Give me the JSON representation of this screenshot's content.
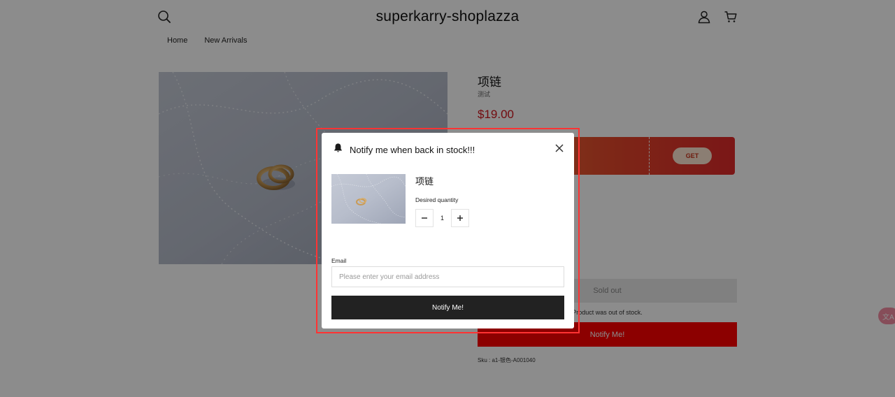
{
  "header": {
    "store_title": "superkarry-shoplazza",
    "nav": [
      "Home",
      "New Arrivals"
    ],
    "icons": [
      "search-icon",
      "user-icon",
      "cart-icon"
    ]
  },
  "product": {
    "title": "项链",
    "subtitle": "测试",
    "price": "$19.00",
    "coupon_button": "GET",
    "soldout_label": "Sold out",
    "out_of_stock_message": "Product was out of stock.",
    "notify_button": "Notify Me!",
    "sku": "Sku : a1-银色-A001040"
  },
  "translate_widget": "文A",
  "modal": {
    "title": "Notify me when back in stock!!!",
    "product_name": "项链",
    "quantity_label": "Desired quantity",
    "quantity": "1",
    "email_label": "Email",
    "email_placeholder": "Please enter your email address",
    "submit_label": "Notify Me!"
  },
  "colors": {
    "price": "#d0141c",
    "notify_button": "#ff0000",
    "modal_submit": "#222222",
    "highlight_border": "#ff3333"
  }
}
